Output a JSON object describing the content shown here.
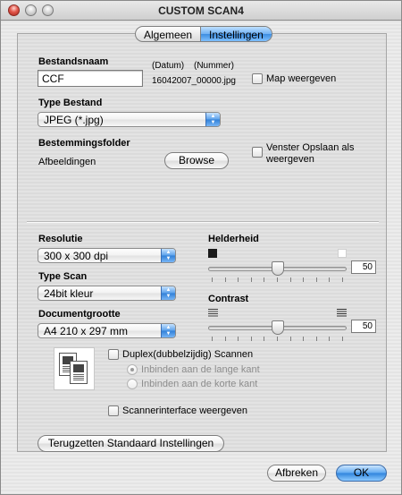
{
  "window": {
    "title": "CUSTOM SCAN4"
  },
  "tabs": [
    {
      "label": "Algemeen",
      "active": false
    },
    {
      "label": "Instellingen",
      "active": true
    }
  ],
  "file": {
    "name_label": "Bestandsnaam",
    "name_value": "CCF",
    "date_label": "(Datum)",
    "number_label": "(Nummer)",
    "generated_name": "16042007_00000.jpg",
    "show_folder_label": "Map weergeven",
    "show_folder_checked": false,
    "type_label": "Type Bestand",
    "type_value": "JPEG (*.jpg)",
    "dest_label": "Bestemmingsfolder",
    "dest_value": "Afbeeldingen",
    "browse_label": "Browse",
    "save_window_label_1": "Venster Opslaan als",
    "save_window_label_2": "weergeven",
    "save_window_checked": false
  },
  "scan": {
    "resolution_label": "Resolutie",
    "resolution_value": "300 x 300 dpi",
    "scan_type_label": "Type Scan",
    "scan_type_value": "24bit kleur",
    "doc_size_label": "Documentgrootte",
    "doc_size_value": "A4  210 x 297 mm",
    "brightness_label": "Helderheid",
    "brightness_value": "50",
    "contrast_label": "Contrast",
    "contrast_value": "50",
    "duplex_label": "Duplex(dubbelzijdig) Scannen",
    "duplex_checked": false,
    "binding_long": "Inbinden aan de lange kant",
    "binding_short": "Inbinden aan de korte kant",
    "scanner_interface_label": "Scannerinterface weergeven",
    "scanner_interface_checked": false
  },
  "buttons": {
    "reset": "Terugzetten Standaard Instellingen",
    "cancel": "Afbreken",
    "ok": "OK"
  },
  "colors": {
    "accent": "#3d8de0",
    "panel_border": "#a6a6a6"
  },
  "icons": [
    "close-icon",
    "minimize-icon",
    "zoom-icon",
    "popup-arrows-icon",
    "dark-square-icon",
    "light-square-icon",
    "contrast-low-icon",
    "contrast-high-icon",
    "duplex-pages-icon"
  ]
}
